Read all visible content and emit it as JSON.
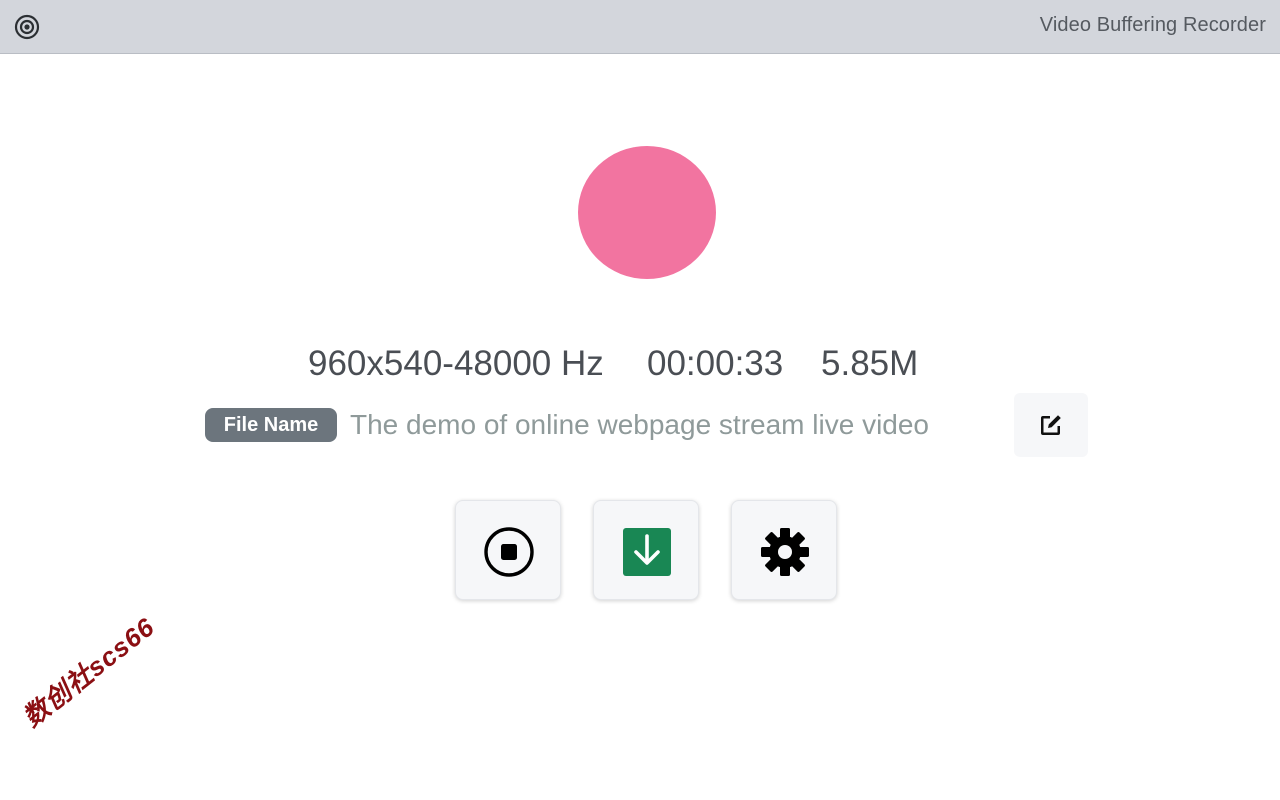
{
  "window": {
    "title": "Video Buffering Recorder",
    "icon": "target-icon"
  },
  "recorder": {
    "indicator_color": "#f274a0",
    "resolution_rate": "960x540-48000 Hz",
    "elapsed": "00:00:33",
    "size": "5.85M"
  },
  "file": {
    "badge_label": "File Name",
    "name": "The demo of online webpage stream live video",
    "edit_icon": "edit-icon"
  },
  "actions": {
    "stop_icon": "stop-circle-icon",
    "download_icon": "download-icon",
    "download_color": "#198754",
    "settings_icon": "gear-icon"
  },
  "watermark": {
    "text": "数创社scs66"
  }
}
